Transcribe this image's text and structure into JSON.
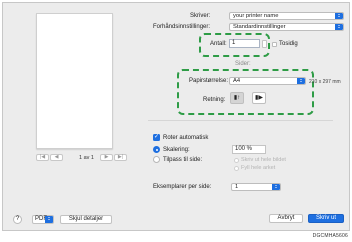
{
  "preview": {
    "page_indicator": "1 av 1",
    "first_page_icon": "first-page-icon",
    "prev_page_icon": "prev-page-icon",
    "next_page_icon": "next-page-icon",
    "last_page_icon": "last-page-icon"
  },
  "printer": {
    "label": "Skriver:",
    "value": "your printer name"
  },
  "presets": {
    "label": "Forhåndsinnstillinger:",
    "value": "Standardinnstillinger"
  },
  "copies": {
    "label": "Antall:",
    "value": "1",
    "two_sided_label": "Tosidig"
  },
  "pages": {
    "label": "Sider:"
  },
  "paper": {
    "label": "Papirstørrelse:",
    "value": "A4",
    "dimensions": "210 x 297 mm"
  },
  "orientation": {
    "label": "Retning:",
    "portrait_icon": "portrait-orientation-icon",
    "landscape_icon": "landscape-orientation-icon"
  },
  "auto_rotate": {
    "label": "Roter automatisk",
    "checked": true
  },
  "scaling": {
    "label": "Skalering:",
    "value": "100 %",
    "fit_label": "Tilpass til side:",
    "fit_option_1": "Skriv ut hele bildet",
    "fit_option_2": "Fyll hele arket"
  },
  "copies_per_page": {
    "label": "Eksemplarer per side:",
    "value": "1"
  },
  "footer": {
    "help": "?",
    "pdf_label": "PDF",
    "hide_details": "Skjul detaljer",
    "cancel": "Avbryt",
    "print": "Skriv ut"
  },
  "figure_id": "DGCMHA5606",
  "colors": {
    "accent": "#1e6fe0",
    "highlight_dash": "#2e9c46"
  }
}
